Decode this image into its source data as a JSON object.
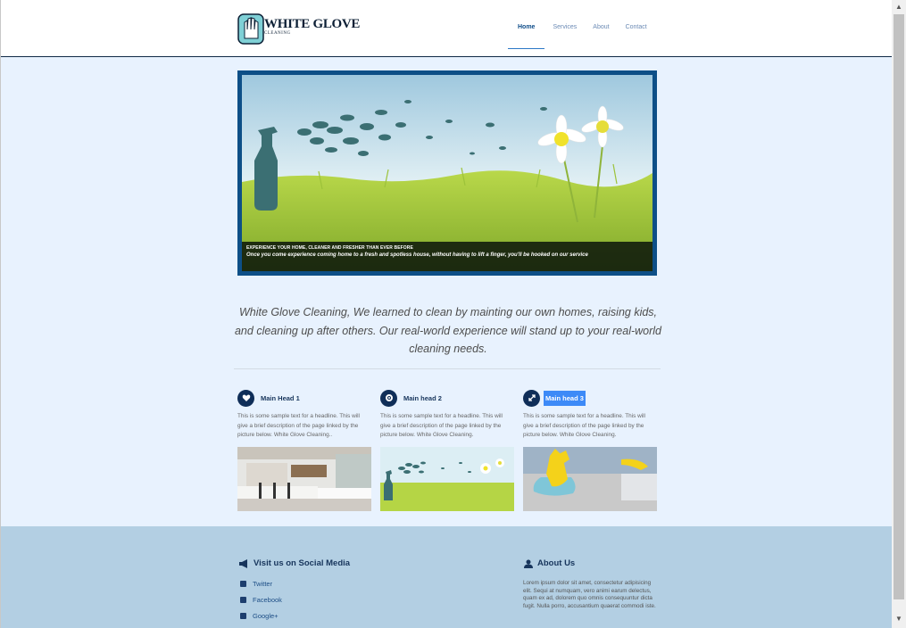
{
  "header": {
    "logo_text": "WHITE GLOVE",
    "logo_sub": "CLEANING",
    "nav": [
      "Home",
      "Services",
      "About",
      "Contact"
    ]
  },
  "hero": {
    "caption_title": "EXPERIENCE YOUR HOME, CLEANER AND FRESHER THAN EVER BEFORE",
    "caption_text": "Once you come experience coming home to a fresh and spotless house, without having to lift a finger, you'll be hooked on our service"
  },
  "intro": "White Glove Cleaning, We learned to clean by mainting our own homes, raising kids, and cleaning up after others. Our real-world experience will stand up to your real-world cleaning needs.",
  "columns": [
    {
      "title": "Main Head 1",
      "icon": "heart-icon",
      "text": "This is some sample text for a headline. This will give a brief description of the page linked by the picture below. White Glove Cleaning.."
    },
    {
      "title": "Main head 2",
      "icon": "gear-icon",
      "text": "This is some sample text for a headline. This will give a brief description of the page linked by the picture below. White Glove Cleaning."
    },
    {
      "title": "Main head 3",
      "icon": "expand-icon",
      "text": "This is some sample text for a headline. This will give a brief description of the page linked by the picture below. White Glove Cleaning."
    }
  ],
  "footer": {
    "social_title": "Visit us on Social Media",
    "social_links": [
      "Twitter",
      "Facebook",
      "Google+"
    ],
    "about_title": "About Us",
    "about_text": "Lorem ipsum dolor sit amet, consectetur adipisicing elit. Sequi at numquam, vero animi earum delectus, quam ex ad, dolorem quo omnis consequuntur dicta fugit. Nulla porro, accusantium quaerat commodi iste."
  },
  "colors": {
    "accent": "#0d4f87",
    "footer_bg": "#b3cfe3",
    "page_bg": "#e8f2fe",
    "highlight": "#3d8af7"
  }
}
